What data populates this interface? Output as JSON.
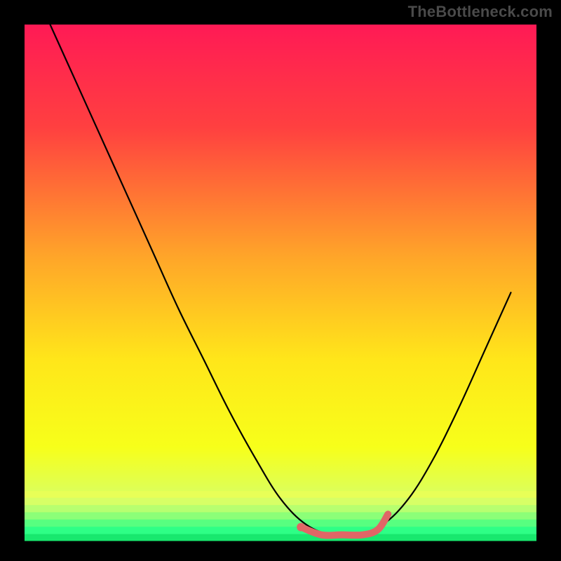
{
  "watermark": "TheBottleneck.com",
  "chart_data": {
    "type": "line",
    "title": "",
    "xlabel": "",
    "ylabel": "",
    "xlim": [
      0,
      100
    ],
    "ylim": [
      0,
      100
    ],
    "grid": false,
    "legend": false,
    "background_gradient": {
      "stops": [
        {
          "offset": 0.0,
          "color": "#ff1a55"
        },
        {
          "offset": 0.2,
          "color": "#ff4040"
        },
        {
          "offset": 0.45,
          "color": "#ffa529"
        },
        {
          "offset": 0.65,
          "color": "#ffe61a"
        },
        {
          "offset": 0.82,
          "color": "#f7ff1a"
        },
        {
          "offset": 0.925,
          "color": "#d7ff66"
        },
        {
          "offset": 0.98,
          "color": "#2eff86"
        },
        {
          "offset": 1.0,
          "color": "#18e86e"
        }
      ]
    },
    "series": [
      {
        "name": "bottleneck-curve",
        "color": "#000000",
        "note": "x in [0,100] is horizontal plot fraction, y is percent-from-top (0=top, 100=bottom)",
        "points": [
          {
            "x": 5,
            "y": 0
          },
          {
            "x": 10,
            "y": 11
          },
          {
            "x": 15,
            "y": 22
          },
          {
            "x": 20,
            "y": 33
          },
          {
            "x": 25,
            "y": 44
          },
          {
            "x": 30,
            "y": 55
          },
          {
            "x": 35,
            "y": 65
          },
          {
            "x": 40,
            "y": 75
          },
          {
            "x": 45,
            "y": 84
          },
          {
            "x": 50,
            "y": 92
          },
          {
            "x": 55,
            "y": 97
          },
          {
            "x": 60,
            "y": 99
          },
          {
            "x": 65,
            "y": 99
          },
          {
            "x": 70,
            "y": 97
          },
          {
            "x": 75,
            "y": 92
          },
          {
            "x": 80,
            "y": 84
          },
          {
            "x": 85,
            "y": 74
          },
          {
            "x": 90,
            "y": 63
          },
          {
            "x": 95,
            "y": 52
          }
        ]
      },
      {
        "name": "highlight-band",
        "color": "#e06666",
        "note": "flat ideal-zone marker at the trough",
        "points": [
          {
            "x": 54,
            "y": 97.5
          },
          {
            "x": 58,
            "y": 99
          },
          {
            "x": 62,
            "y": 99
          },
          {
            "x": 66,
            "y": 99
          },
          {
            "x": 69,
            "y": 98
          },
          {
            "x": 71,
            "y": 95
          }
        ]
      }
    ]
  }
}
